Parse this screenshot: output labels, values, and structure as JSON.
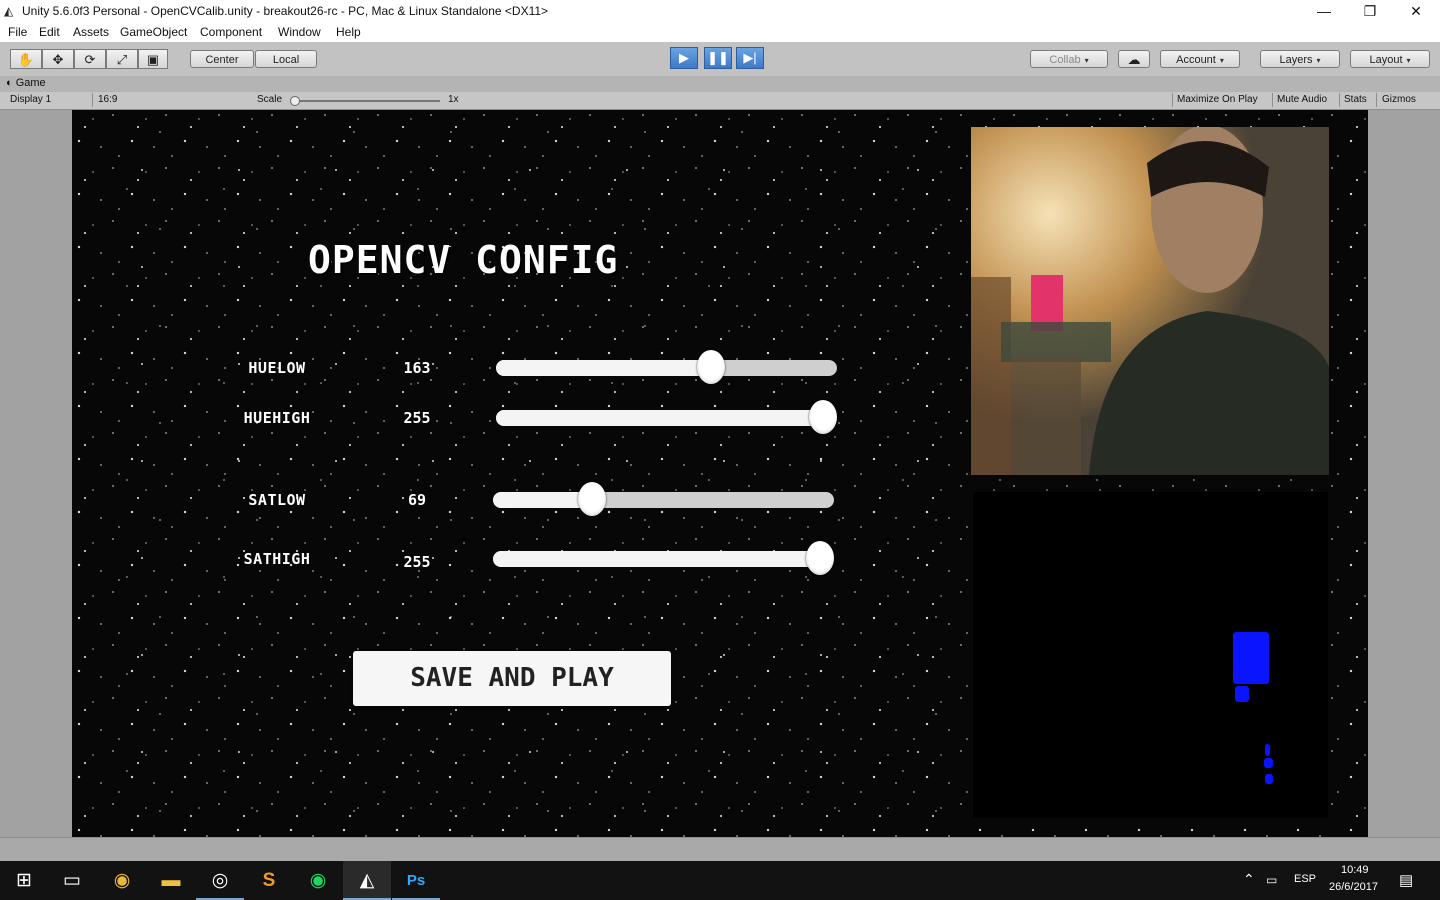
{
  "window": {
    "title": "Unity 5.6.0f3 Personal - OpenCVCalib.unity - breakout26-rc - PC, Mac & Linux Standalone <DX11>",
    "minimize": "—",
    "restore": "❐",
    "close": "✕"
  },
  "menu": [
    "File",
    "Edit",
    "Assets",
    "GameObject",
    "Component",
    "Window",
    "Help"
  ],
  "toolbar": {
    "tools": [
      "hand-icon",
      "move-icon",
      "rotate-icon",
      "scale-icon",
      "rect-icon"
    ],
    "tool_glyphs": [
      "✋",
      "✥",
      "⟳",
      "⤢",
      "▣"
    ],
    "pivot_label": "Center",
    "space_label": "Local",
    "play_glyph": "▶",
    "pause_glyph": "❚❚",
    "step_glyph": "▶|",
    "collab_label": "Collab",
    "cloud_glyph": "☁",
    "account_label": "Account",
    "layers_label": "Layers",
    "layout_label": "Layout",
    "dropdown_glyph": "▾"
  },
  "game_tab": {
    "label": "Game",
    "display": "Display 1",
    "aspect": "16:9",
    "scale_label": "Scale",
    "scale_value": "1x",
    "maximize_on_play": "Maximize On Play",
    "mute_audio": "Mute Audio",
    "stats": "Stats",
    "gizmos": "Gizmos"
  },
  "game": {
    "title": "OPENCV CONFIG",
    "sliders": [
      {
        "label": "HUELOW",
        "value": "163",
        "fraction": 0.63
      },
      {
        "label": "HUEHIGH",
        "value": "255",
        "fraction": 0.96
      },
      {
        "label": "SATLOW",
        "value": "69",
        "fraction": 0.29
      },
      {
        "label": "SATHIGH",
        "value": "255",
        "fraction": 0.96
      }
    ],
    "save_button": "SAVE AND PLAY"
  },
  "taskbar": {
    "apps": [
      "windows-start-icon",
      "task-view-icon",
      "chrome-icon",
      "file-explorer-icon",
      "obs-icon",
      "sublime-text-icon",
      "spotify-icon",
      "unity-icon",
      "photoshop-icon"
    ],
    "app_glyphs": [
      "⊞",
      "▭",
      "◉",
      "▬",
      "◎",
      "S",
      "◉",
      "◭",
      "Ps"
    ],
    "language": "ESP",
    "time": "10:49",
    "date": "26/6/2017",
    "tray_chevron": "⌃",
    "notifications_glyph": "▤"
  }
}
